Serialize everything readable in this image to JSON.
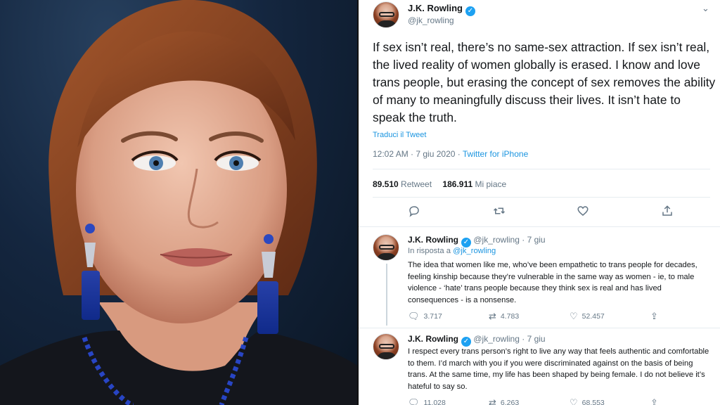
{
  "main_tweet": {
    "author_name": "J.K. Rowling",
    "author_handle": "@jk_rowling",
    "verified_glyph": "✓",
    "text": "If sex isn’t real, there’s no same-sex attraction. If sex isn’t real, the lived reality of women globally is erased. I know and love trans people, but erasing the concept of sex removes the ability of many to meaningfully discuss their lives. It isn’t hate to speak the truth.",
    "translate_label": "Traduci il Tweet",
    "timestamp": "12:02 AM · 7 giu 2020 · ",
    "client": "Twitter for iPhone",
    "retweet_count": "89.510",
    "retweet_label": "Retweet",
    "like_count": "186.911",
    "like_label": "Mi piace",
    "icons": [
      "reply-icon",
      "retweet-icon",
      "like-icon",
      "share-icon"
    ]
  },
  "replies": [
    {
      "author_name": "J.K. Rowling",
      "author_handle": "@jk_rowling",
      "date": "· 7 giu",
      "in_reply_prefix": "In risposta a ",
      "in_reply_handle": "@jk_rowling",
      "text": "The idea that women like me, who’ve been empathetic to trans people for decades, feeling kinship because they’re vulnerable in the same way as women - ie, to male violence - ‘hate’ trans people because they think sex is real and has lived consequences - is a nonsense.",
      "reply_count": "3.717",
      "retweet_count": "4.783",
      "like_count": "52.457"
    },
    {
      "author_name": "J.K. Rowling",
      "author_handle": "@jk_rowling",
      "date": "· 7 giu",
      "text": "I respect every trans person’s right to live any way that feels authentic and comfortable to them. I’d march with you if you were discriminated against on the basis of being trans. At the same time, my life has been shaped by being female. I do not believe it’s hateful to say so.",
      "reply_count": "11.028",
      "retweet_count": "6.263",
      "like_count": "68.553"
    }
  ],
  "colors": {
    "link": "#1b95e0",
    "verified": "#1da1f2",
    "muted": "#657786",
    "text": "#14171a"
  }
}
